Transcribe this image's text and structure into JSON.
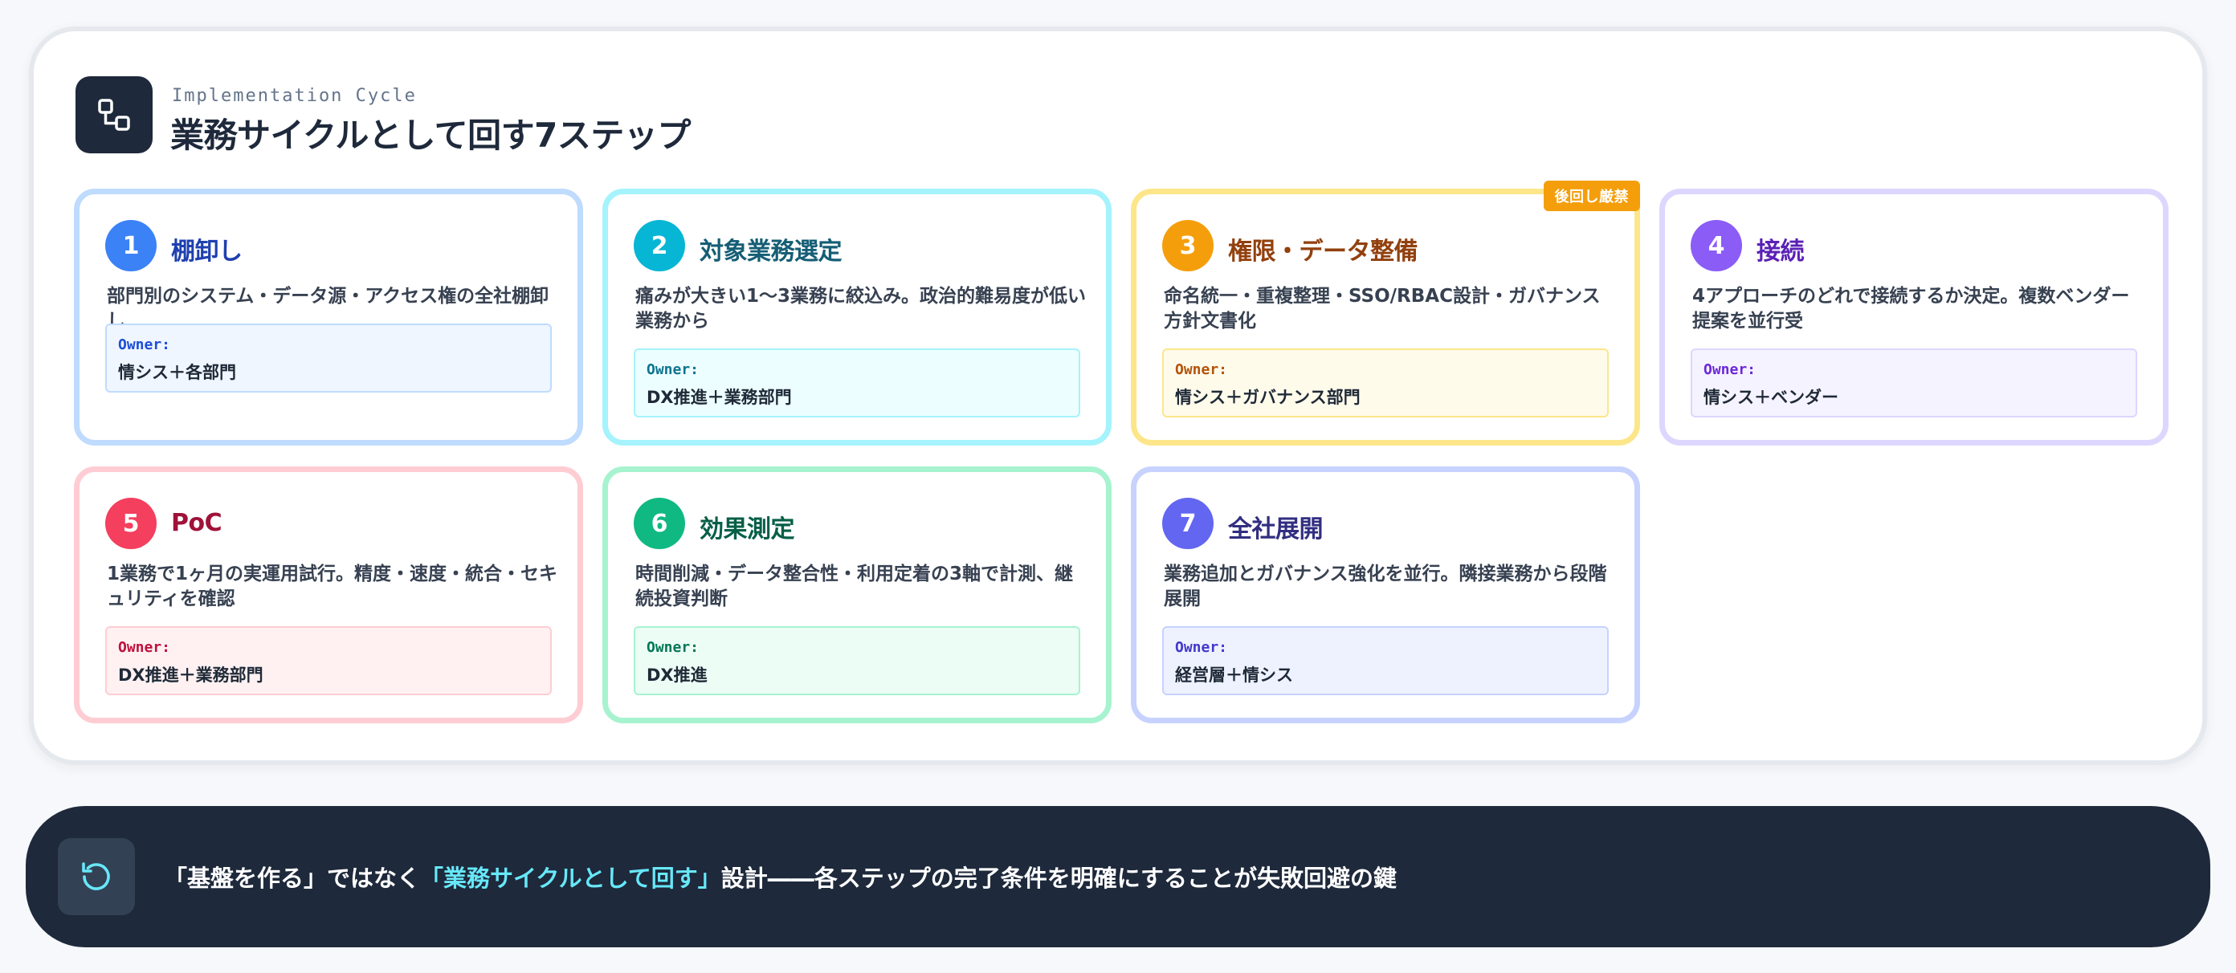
{
  "header": {
    "eyebrow": "Implementation Cycle",
    "title": "業務サイクルとして回す7ステップ",
    "icon": "workflow-icon"
  },
  "owner_label": "Owner:",
  "steps": [
    {
      "number": "1",
      "title": "棚卸し",
      "description": "部門別のシステム・データ源・アクセス権の全社棚卸し",
      "owner": "情シス＋各部門",
      "accent": "#3b82f6",
      "title_color": "#1e40af",
      "border": "#bfdbfe",
      "owner_bg": "#eff6ff",
      "owner_border": "#bfdbfe",
      "owner_label_color": "#1d4ed8"
    },
    {
      "number": "2",
      "title": "対象業務選定",
      "description": "痛みが大きい1〜3業務に絞込み。政治的難易度が低い業務から",
      "owner": "DX推進＋業務部門",
      "accent": "#06b6d4",
      "title_color": "#155e75",
      "border": "#a5f3fc",
      "owner_bg": "#ecfeff",
      "owner_border": "#a5f3fc",
      "owner_label_color": "#0e7490"
    },
    {
      "number": "3",
      "title": "権限・データ整備",
      "description": "命名統一・重複整理・SSO/RBAC設計・ガバナンス方針文書化",
      "owner": "情シス＋ガバナンス部門",
      "badge": "後回し厳禁",
      "accent": "#f59e0b",
      "title_color": "#92400e",
      "border": "#fde68a",
      "owner_bg": "#fffbeb",
      "owner_border": "#fde68a",
      "owner_label_color": "#b45309"
    },
    {
      "number": "4",
      "title": "接続",
      "description": "4アプローチのどれで接続するか決定。複数ベンダー提案を並行受",
      "owner": "情シス＋ベンダー",
      "accent": "#8b5cf6",
      "title_color": "#5b21b6",
      "border": "#ddd6fe",
      "owner_bg": "#f5f3ff",
      "owner_border": "#ddd6fe",
      "owner_label_color": "#6d28d9"
    },
    {
      "number": "5",
      "title": "PoC",
      "description": "1業務で1ヶ月の実運用試行。精度・速度・統合・セキュリティを確認",
      "owner": "DX推進＋業務部門",
      "accent": "#f43f5e",
      "title_color": "#9f1239",
      "border": "#fecdd3",
      "owner_bg": "#fff1f2",
      "owner_border": "#fecdd3",
      "owner_label_color": "#be123c"
    },
    {
      "number": "6",
      "title": "効果測定",
      "description": "時間削減・データ整合性・利用定着の3軸で計測、継続投資判断",
      "owner": "DX推進",
      "accent": "#10b981",
      "title_color": "#065f46",
      "border": "#a7f3d0",
      "owner_bg": "#ecfdf5",
      "owner_border": "#a7f3d0",
      "owner_label_color": "#047857"
    },
    {
      "number": "7",
      "title": "全社展開",
      "description": "業務追加とガバナンス強化を並行。隣接業務から段階展開",
      "owner": "経営層＋情シス",
      "accent": "#6366f1",
      "title_color": "#312e81",
      "border": "#c7d2fe",
      "owner_bg": "#eef2ff",
      "owner_border": "#c7d2fe",
      "owner_label_color": "#4338ca"
    }
  ],
  "banner": {
    "icon": "refresh-cycle-icon",
    "text_before": "「基盤を作る」ではなく",
    "text_highlight": "「業務サイクルとして回す」",
    "text_after": "設計――各ステップの完了条件を明確にすることが失敗回避の鍵",
    "highlight_color": "#67e8f9"
  }
}
